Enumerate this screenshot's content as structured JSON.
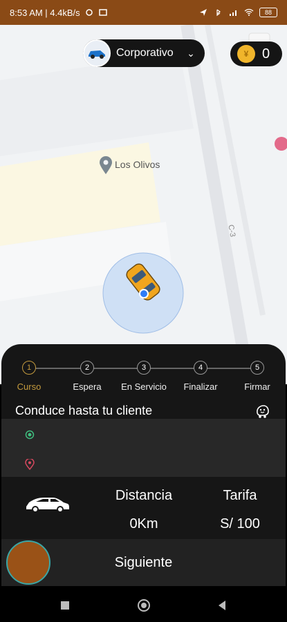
{
  "status": {
    "time_net": "8:53 AM | 4.4kB/s",
    "battery": "88"
  },
  "top": {
    "mode_label": "Corporativo",
    "coins": "0"
  },
  "map": {
    "place_label": "Los Olivos",
    "street_label": "C-3"
  },
  "steps": [
    {
      "num": "1",
      "label": "Curso"
    },
    {
      "num": "2",
      "label": "Espera"
    },
    {
      "num": "3",
      "label": "En Servicio"
    },
    {
      "num": "4",
      "label": "Finalizar"
    },
    {
      "num": "5",
      "label": "Firmar"
    }
  ],
  "panel": {
    "title": "Conduce hasta tu cliente",
    "distance_label": "Distancia",
    "distance_value": "0Km",
    "fare_label": "Tarifa",
    "fare_value": "S/ 100",
    "next_label": "Siguiente"
  },
  "colors": {
    "accent": "#c49a3d",
    "statusbar": "#8a4a16",
    "panel": "#161616"
  }
}
